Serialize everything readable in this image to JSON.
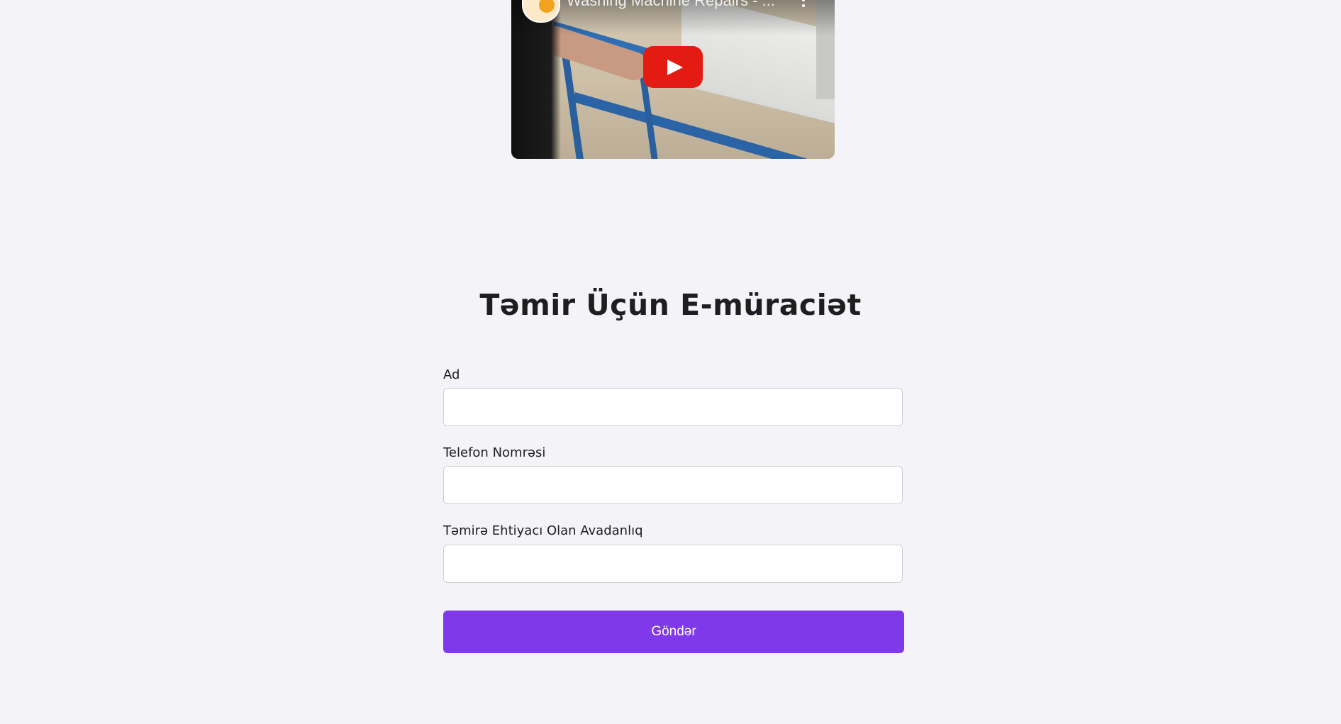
{
  "video": {
    "title": "Washing Machine Repairs - ...",
    "channel_icon": "channel-logo-icon",
    "play_icon": "youtube-play-icon",
    "menu_icon": "more-vertical-icon"
  },
  "form": {
    "title": "Təmir Üçün E-müraciət",
    "fields": [
      {
        "label": "Ad",
        "value": "",
        "placeholder": ""
      },
      {
        "label": "Telefon Nomrəsi",
        "value": "",
        "placeholder": ""
      },
      {
        "label": "Təmirə Ehtiyacı Olan Avadanlıq",
        "value": "",
        "placeholder": ""
      }
    ],
    "submit_label": "Göndər"
  },
  "colors": {
    "background": "#f4f4f8",
    "accent": "#8039ea",
    "youtube_red": "#e41b13"
  }
}
